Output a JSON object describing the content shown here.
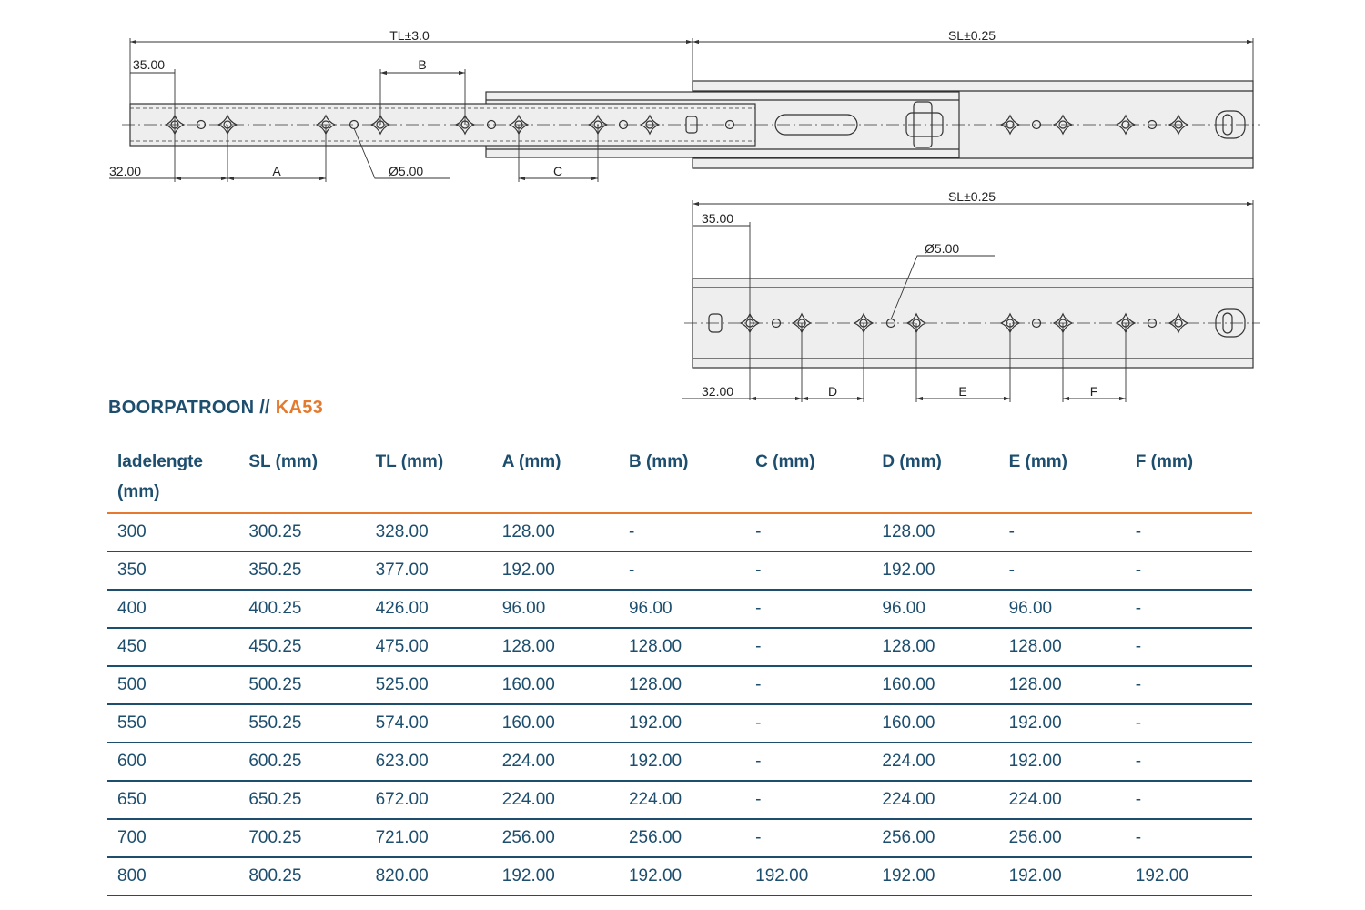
{
  "drawing": {
    "top": {
      "tl_label": "TL±3.0",
      "sl_label": "SL±0.25",
      "dim_35": "35.00",
      "dim_32": "32.00",
      "dim_a": "A",
      "dim_b": "B",
      "dim_c": "C",
      "hole_dia": "Ø5.00"
    },
    "bottom": {
      "sl_label": "SL±0.25",
      "dim_35": "35.00",
      "dim_32": "32.00",
      "dim_d": "D",
      "dim_e": "E",
      "dim_f": "F",
      "hole_dia": "Ø5.00"
    }
  },
  "title": {
    "prefix": "BOORPATROON // ",
    "model": "KA53"
  },
  "table": {
    "headers": [
      "ladelengte (mm)",
      "SL (mm)",
      "TL (mm)",
      "A (mm)",
      "B (mm)",
      "C (mm)",
      "D (mm)",
      "E (mm)",
      "F (mm)"
    ],
    "rows": [
      [
        "300",
        "300.25",
        "328.00",
        "128.00",
        "-",
        "-",
        "128.00",
        "-",
        "-"
      ],
      [
        "350",
        "350.25",
        "377.00",
        "192.00",
        "-",
        "-",
        "192.00",
        "-",
        "-"
      ],
      [
        "400",
        "400.25",
        "426.00",
        "96.00",
        "96.00",
        "-",
        "96.00",
        "96.00",
        "-"
      ],
      [
        "450",
        "450.25",
        "475.00",
        "128.00",
        "128.00",
        "-",
        "128.00",
        "128.00",
        "-"
      ],
      [
        "500",
        "500.25",
        "525.00",
        "160.00",
        "128.00",
        "-",
        "160.00",
        "128.00",
        "-"
      ],
      [
        "550",
        "550.25",
        "574.00",
        "160.00",
        "192.00",
        "-",
        "160.00",
        "192.00",
        "-"
      ],
      [
        "600",
        "600.25",
        "623.00",
        "224.00",
        "192.00",
        "-",
        "224.00",
        "192.00",
        "-"
      ],
      [
        "650",
        "650.25",
        "672.00",
        "224.00",
        "224.00",
        "-",
        "224.00",
        "224.00",
        "-"
      ],
      [
        "700",
        "700.25",
        "721.00",
        "256.00",
        "256.00",
        "-",
        "256.00",
        "256.00",
        "-"
      ],
      [
        "800",
        "800.25",
        "820.00",
        "192.00",
        "192.00",
        "192.00",
        "192.00",
        "192.00",
        "192.00"
      ]
    ]
  }
}
